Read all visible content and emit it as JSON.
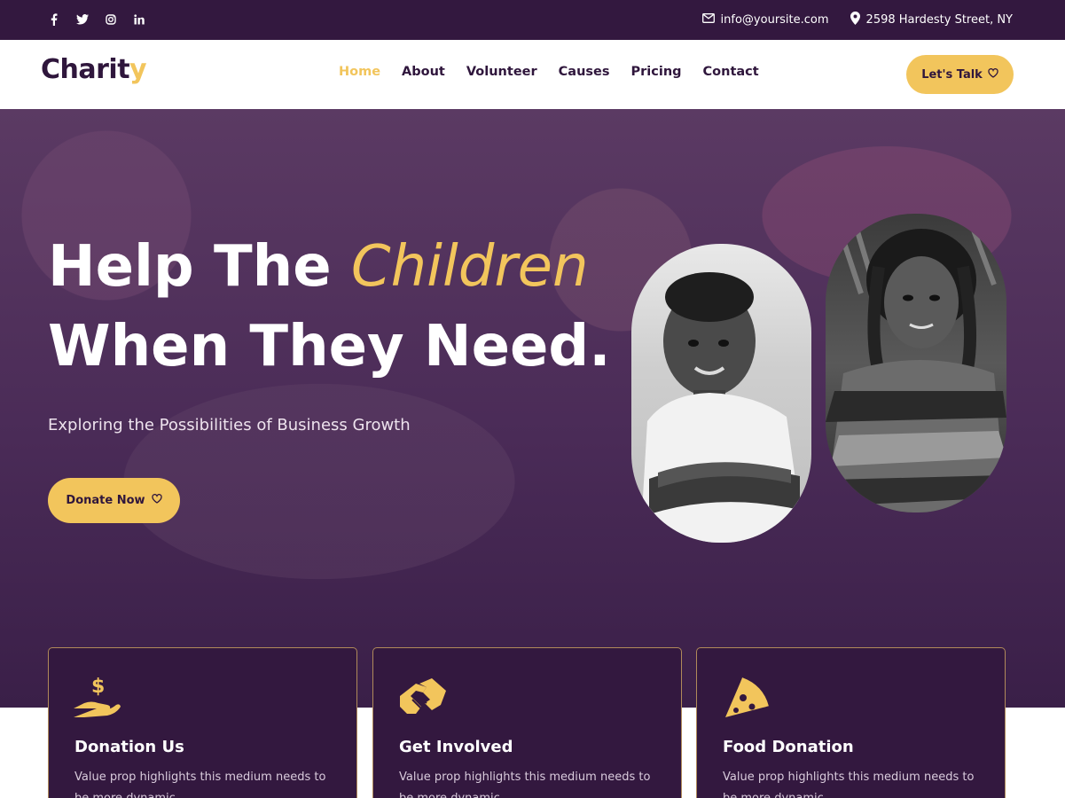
{
  "topbar": {
    "social": [
      "facebook-icon",
      "twitter-icon",
      "instagram-icon",
      "linkedin-icon"
    ],
    "email": "info@yoursite.com",
    "address": "2598 Hardesty Street, NY"
  },
  "header": {
    "logo_main": "Charit",
    "logo_accent": "y",
    "nav": [
      "Home",
      "About",
      "Volunteer",
      "Causes",
      "Pricing",
      "Contact"
    ],
    "active_nav": "Home",
    "cta": "Let's Talk"
  },
  "hero": {
    "title_part1": "Help The",
    "title_highlight": "Children",
    "title_line2": "When They Need.",
    "subtitle": "Exploring the Possibilities of Business Growth",
    "donate_label": "Donate Now"
  },
  "cards": [
    {
      "icon": "money-hand-icon",
      "title": "Donation Us",
      "text": "Value prop highlights this medium needs to be more dynamic"
    },
    {
      "icon": "handshake-icon",
      "title": "Get Involved",
      "text": "Value prop highlights this medium needs to be more dynamic"
    },
    {
      "icon": "pizza-icon",
      "title": "Food Donation",
      "text": "Value prop highlights this medium needs to be more dynamic"
    }
  ],
  "colors": {
    "brand_dark": "#33183f",
    "accent_yellow": "#f2c55c",
    "hero_overlay": "#4a2b57"
  }
}
